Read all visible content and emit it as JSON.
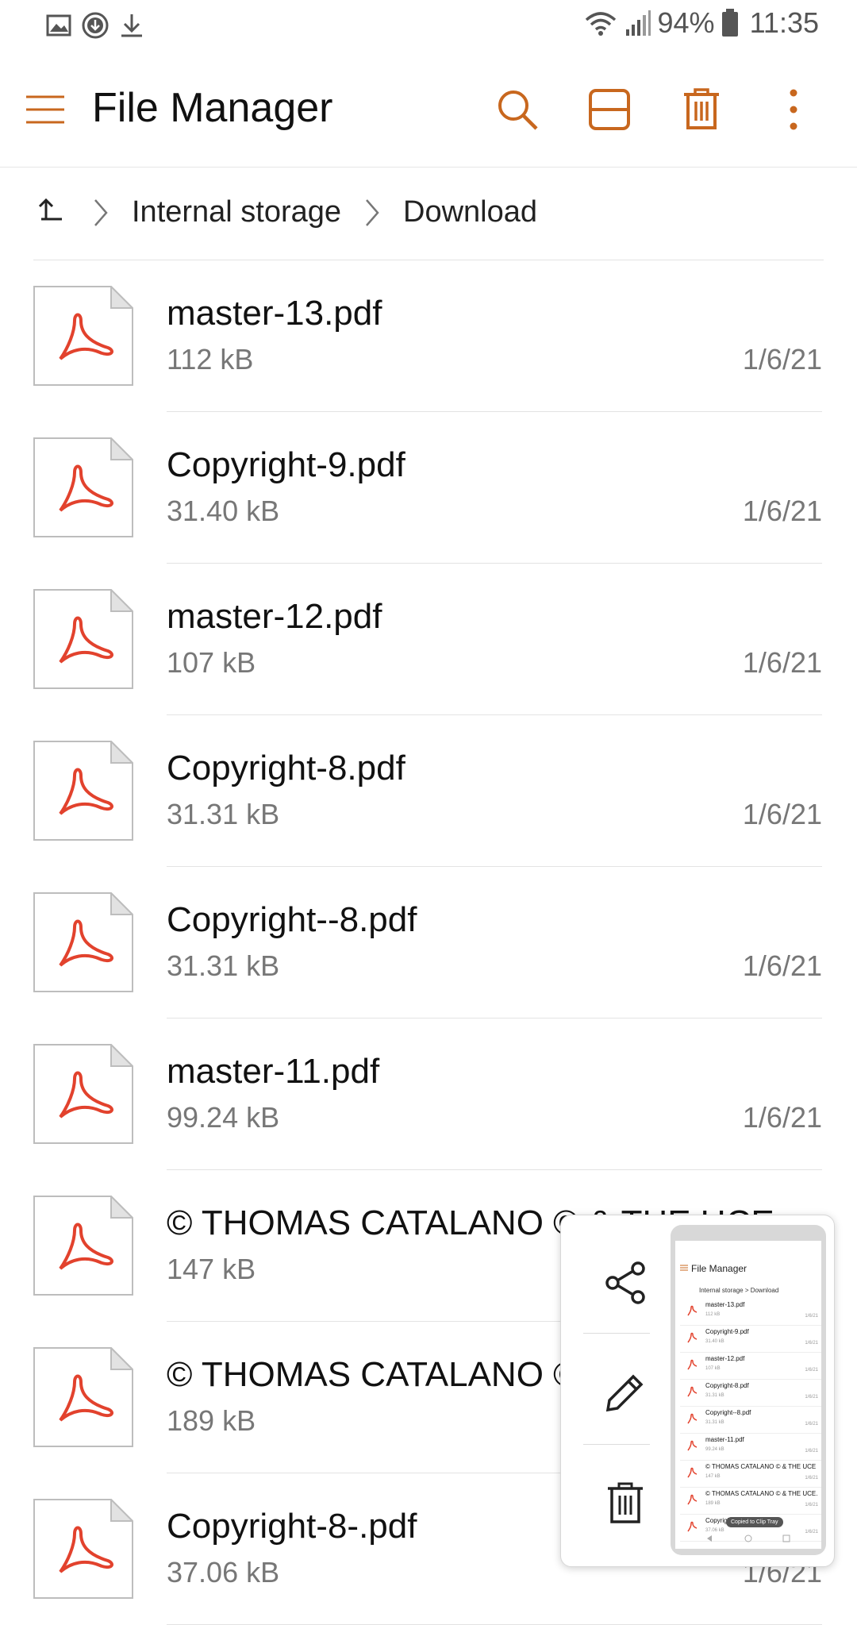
{
  "status_bar": {
    "battery": "94%",
    "time": "11:35",
    "left_icons": [
      "image-icon",
      "download-circle-icon",
      "download-icon"
    ],
    "right_icons": [
      "wifi-icon",
      "signal-icon",
      "battery-icon"
    ]
  },
  "app_bar": {
    "title": "File Manager",
    "actions": [
      "search-icon",
      "view-toggle-icon",
      "delete-icon",
      "more-icon"
    ],
    "accent_color": "#c8671e"
  },
  "breadcrumb": {
    "items": [
      "Internal storage",
      "Download"
    ]
  },
  "files": [
    {
      "name": "master-13.pdf",
      "size": "112 kB",
      "date": "1/6/21"
    },
    {
      "name": "Copyright-9.pdf",
      "size": "31.40 kB",
      "date": "1/6/21"
    },
    {
      "name": "master-12.pdf",
      "size": "107 kB",
      "date": "1/6/21"
    },
    {
      "name": "Copyright-8.pdf",
      "size": "31.31 kB",
      "date": "1/6/21"
    },
    {
      "name": "Copyright--8.pdf",
      "size": "31.31 kB",
      "date": "1/6/21"
    },
    {
      "name": "master-11.pdf",
      "size": "99.24 kB",
      "date": "1/6/21"
    },
    {
      "name": "© THOMAS CATALANO © & THE UCE",
      "size": "147 kB",
      "date": ""
    },
    {
      "name": "© THOMAS CATALANO ©",
      "size": "189 kB",
      "date": ""
    },
    {
      "name": "Copyright-8-.pdf",
      "size": "37.06 kB",
      "date": "1/6/21"
    }
  ],
  "screenshot_popup": {
    "actions": [
      "share-icon",
      "edit-icon",
      "delete-icon"
    ],
    "thumbnail": {
      "title": "File Manager",
      "crumb": "Internal storage > Download",
      "rows": [
        {
          "name": "master-13.pdf",
          "size": "112 kB",
          "date": "1/6/21"
        },
        {
          "name": "Copyright-9.pdf",
          "size": "31.40 kB",
          "date": "1/6/21"
        },
        {
          "name": "master-12.pdf",
          "size": "107 kB",
          "date": "1/6/21"
        },
        {
          "name": "Copyright-8.pdf",
          "size": "31.31 kB",
          "date": "1/6/21"
        },
        {
          "name": "Copyright--8.pdf",
          "size": "31.31 kB",
          "date": "1/6/21"
        },
        {
          "name": "master-11.pdf",
          "size": "99.24 kB",
          "date": "1/6/21"
        },
        {
          "name": "© THOMAS CATALANO © & THE UCE",
          "size": "147 kB",
          "date": "1/6/21"
        },
        {
          "name": "© THOMAS CATALANO © & THE UCE.",
          "size": "189 kB",
          "date": "1/6/21"
        },
        {
          "name": "Copyright",
          "size": "37.06 kB",
          "date": "1/6/21"
        }
      ],
      "tooltip": "Copied to Clip Tray"
    }
  }
}
